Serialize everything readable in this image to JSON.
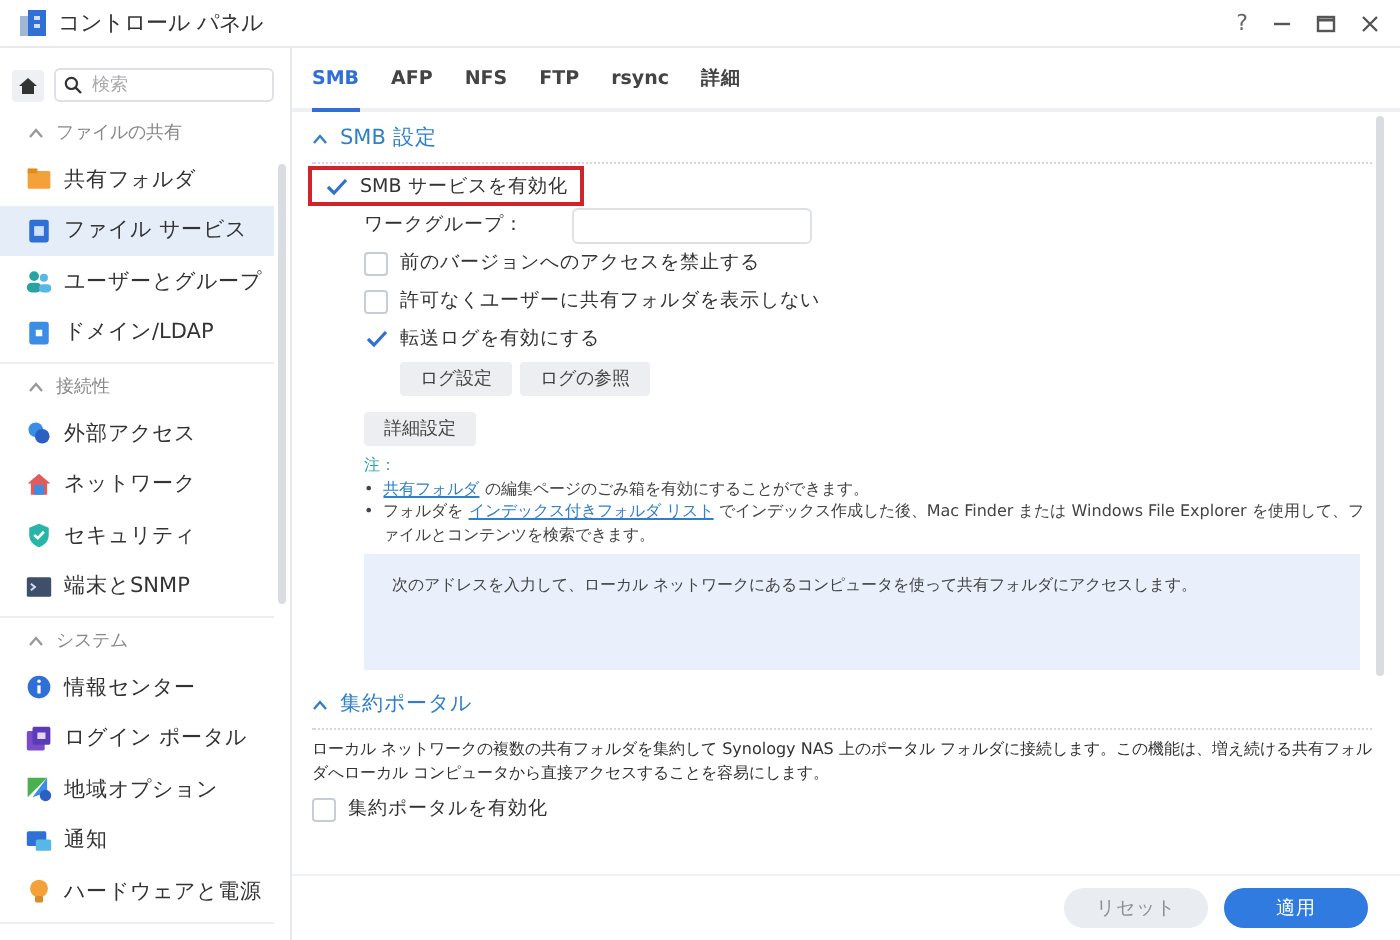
{
  "window": {
    "title": "コントロール パネル",
    "help": "?"
  },
  "sidebar": {
    "search": {
      "placeholder": "検索"
    },
    "groups": [
      {
        "title": "ファイルの共有",
        "items": [
          {
            "label": "共有フォルダ",
            "selected": false
          },
          {
            "label": "ファイル サービス",
            "selected": true
          },
          {
            "label": "ユーザーとグループ",
            "selected": false
          },
          {
            "label": "ドメイン/LDAP",
            "selected": false
          }
        ]
      },
      {
        "title": "接続性",
        "items": [
          {
            "label": "外部アクセス",
            "selected": false
          },
          {
            "label": "ネットワーク",
            "selected": false
          },
          {
            "label": "セキュリティ",
            "selected": false
          },
          {
            "label": "端末とSNMP",
            "selected": false
          }
        ]
      },
      {
        "title": "システム",
        "items": [
          {
            "label": "情報センター",
            "selected": false
          },
          {
            "label": "ログイン ポータル",
            "selected": false
          },
          {
            "label": "地域オプション",
            "selected": false
          },
          {
            "label": "通知",
            "selected": false
          },
          {
            "label": "ハードウェアと電源",
            "selected": false
          }
        ]
      }
    ]
  },
  "tabs": [
    {
      "label": "SMB",
      "selected": true
    },
    {
      "label": "AFP",
      "selected": false
    },
    {
      "label": "NFS",
      "selected": false
    },
    {
      "label": "FTP",
      "selected": false
    },
    {
      "label": "rsync",
      "selected": false
    },
    {
      "label": "詳細",
      "selected": false
    }
  ],
  "smb_section": {
    "title": "SMB 設定",
    "enable": {
      "label": "SMB サービスを有効化",
      "checked": true,
      "highlighted": true
    },
    "workgroup": {
      "label": "ワークグループ："
    },
    "options": [
      {
        "label": "前のバージョンへのアクセスを禁止する",
        "checked": false
      },
      {
        "label": "許可なくユーザーに共有フォルダを表示しない",
        "checked": false
      },
      {
        "label": "転送ログを有効にする",
        "checked": true
      }
    ],
    "log_buttons": [
      "ログ設定",
      "ログの参照"
    ],
    "advanced_button": "詳細設定",
    "note": {
      "title": "注：",
      "marker": "•",
      "bullets": [
        [
          {
            "kind": "link",
            "text": "共有フォルダ"
          },
          {
            "kind": "text",
            "text": " の編集ページのごみ箱を有効にすることができます。"
          }
        ],
        [
          {
            "kind": "text",
            "text": "フォルダを "
          },
          {
            "kind": "link",
            "text": "インデックス付きフォルダ リスト"
          },
          {
            "kind": "text",
            "text": " でインデックス作成した後、Mac Finder または Windows File Explorer を使用して、ファイルとコンテンツを検索できます。"
          }
        ]
      ]
    },
    "info_box": "次のアドレスを入力して、ローカル ネットワークにあるコンピュータを使って共有フォルダにアクセスします。"
  },
  "portal_section": {
    "title": "集約ポータル",
    "description": "ローカル ネットワークの複数の共有フォルダを集約して Synology NAS 上のポータル フォルダに接続します。この機能は、増え続ける共有フォルダへローカル コンピュータから直接アクセスすることを容易にします。",
    "enable": {
      "label": "集約ポータルを有効化",
      "checked": false
    }
  },
  "footer": {
    "buttons": [
      {
        "label": "リセット",
        "kind": "secondary"
      },
      {
        "label": "適用",
        "kind": "primary"
      }
    ]
  }
}
